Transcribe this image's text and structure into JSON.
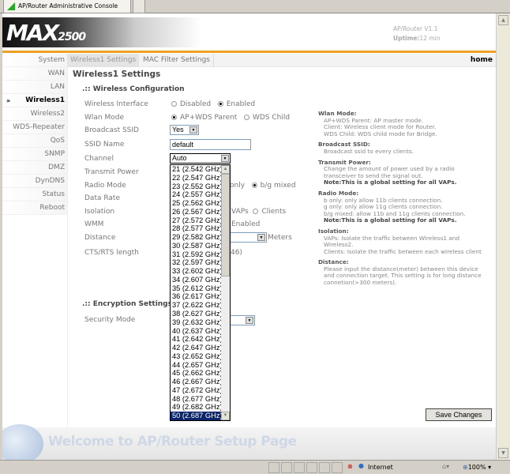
{
  "browser": {
    "tab_title": "AP/Router Administrative Console",
    "zone": "Internet",
    "zoom": "100%"
  },
  "header": {
    "version": "AP/Router V1.1",
    "uptime_label": "Uptime:",
    "uptime_value": "12 min",
    "logo_text": "MAX2500"
  },
  "sidebar": {
    "items": [
      {
        "label": "System"
      },
      {
        "label": "WAN"
      },
      {
        "label": "LAN"
      },
      {
        "label": "Wireless1",
        "active": true
      },
      {
        "label": "Wireless2"
      },
      {
        "label": "WDS-Repeater"
      },
      {
        "label": "QoS"
      },
      {
        "label": "SNMP"
      },
      {
        "label": "DMZ"
      },
      {
        "label": "DynDNS"
      },
      {
        "label": "Status"
      },
      {
        "label": "Reboot"
      }
    ],
    "active_marker": "»"
  },
  "nav": {
    "tabs": [
      {
        "label": "Wireless1 Settings",
        "active": true
      },
      {
        "label": "MAC Filter Settings"
      }
    ],
    "home": "home"
  },
  "main": {
    "title": "Wireless1 Settings",
    "section1": ".:: Wireless Configuration",
    "section2": ".:: Encryption Settings",
    "labels": {
      "wireless_interface": "Wireless Interface",
      "wlan_mode": "Wlan Mode",
      "broadcast_ssid": "Broadcast SSID",
      "ssid_name": "SSID Name",
      "channel": "Channel",
      "transmit_power": "Transmit Power",
      "radio_mode": "Radio Mode",
      "data_rate": "Data Rate",
      "isolation": "Isolation",
      "wmm": "WMM",
      "distance": "Distance",
      "cts_rts": "CTS/RTS length",
      "security_mode": "Security Mode"
    },
    "wireless_interface": {
      "options": [
        "Disabled",
        "Enabled"
      ],
      "selected": "Enabled"
    },
    "wlan_mode": {
      "options": [
        "AP+WDS Parent",
        "WDS Child"
      ],
      "selected": "AP+WDS Parent"
    },
    "broadcast_ssid": "Yes",
    "ssid_name": "default",
    "channel": "Auto",
    "radio_mode_visible": {
      "partial": "only",
      "option": "b/g mixed",
      "selected": "b/g mixed"
    },
    "isolation_visible": {
      "partial": "VAPs",
      "option": "Clients"
    },
    "wmm_visible": "Enabled",
    "distance_unit": "Meters",
    "cts_rts_visible": "46)",
    "save_label": "Save Changes"
  },
  "channel_list": {
    "options": [
      "21 (2.542 GHz)",
      "22 (2.547 GHz)",
      "23 (2.552 GHz)",
      "24 (2.557 GHz)",
      "25 (2.562 GHz)",
      "26 (2.567 GHz)",
      "27 (2.572 GHz)",
      "28 (2.577 GHz)",
      "29 (2.582 GHz)",
      "30 (2.587 GHz)",
      "31 (2.592 GHz)",
      "32 (2.597 GHz)",
      "33 (2.602 GHz)",
      "34 (2.607 GHz)",
      "35 (2.612 GHz)",
      "36 (2.617 GHz)",
      "37 (2.622 GHz)",
      "38 (2.627 GHz)",
      "39 (2.632 GHz)",
      "40 (2.637 GHz)",
      "41 (2.642 GHz)",
      "42 (2.647 GHz)",
      "43 (2.652 GHz)",
      "44 (2.657 GHz)",
      "45 (2.662 GHz)",
      "46 (2.667 GHz)",
      "47 (2.672 GHz)",
      "48 (2.677 GHz)",
      "49 (2.682 GHz)",
      "50 (2.687 GHz)"
    ],
    "highlighted": "50 (2.687 GHz)"
  },
  "help": [
    {
      "title": "Wlan Mode:",
      "lines": [
        "AP+WDS Parent: AP master mode.",
        "Client: Wireless client mode for Router.",
        "WDS Child: WDS child mode for Bridge."
      ]
    },
    {
      "title": "Broadcast SSID:",
      "lines": [
        "Broadcast ssid to every clients."
      ]
    },
    {
      "title": "Transmit Power:",
      "lines": [
        "Change the amount of power used by a radio transceiver to send the signal out."
      ],
      "note": "Note:This is a global setting for all VAPs."
    },
    {
      "title": "Radio Mode:",
      "lines": [
        "b only: only allow 11b clients connection.",
        "g only: only allow 11g clients connection.",
        "b/g mixed: allow 11b and 11g clients connection."
      ],
      "note": "Note:This is a global setting for all VAPs."
    },
    {
      "title": "Isolation:",
      "lines": [
        "VAPs: Isolate the traffic between Wireless1 and Wireless2.",
        "Clients: Isolate the traffic between each wireless client"
      ]
    },
    {
      "title": "Distance:",
      "lines": [
        "Please input the distance(meter) between this device and connection target. This setting is for long distance connetion(>300 meters)."
      ]
    }
  ],
  "footer": {
    "welcome": "Welcome to AP/Router Setup Page"
  }
}
